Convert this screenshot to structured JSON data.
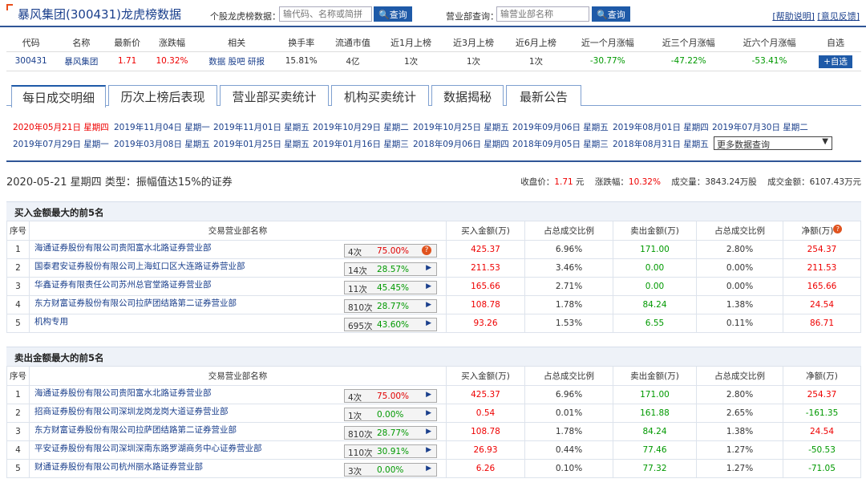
{
  "header": {
    "title": "暴风集团(300431)龙虎榜数据",
    "stock_label": "个股龙虎榜数据：",
    "stock_placeholder": "输代码、名称或简拼",
    "dept_label": "营业部查询：",
    "dept_placeholder": "输营业部名称",
    "search_btn": "查询",
    "help_link": "[帮助说明]",
    "feedback_link": "[意见反馈]"
  },
  "summary": {
    "headers": [
      "代码",
      "名称",
      "最新价",
      "涨跌幅",
      "相关",
      "换手率",
      "流通市值",
      "近1月上榜",
      "近3月上榜",
      "近6月上榜",
      "近一个月涨幅",
      "近三个月涨幅",
      "近六个月涨幅",
      "自选"
    ],
    "code": "300431",
    "name": "暴风集团",
    "price": "1.71",
    "change": "10.32%",
    "rel1": "数据",
    "rel2": "股吧",
    "rel3": "研报",
    "turnover": "15.81%",
    "mktcap": "4亿",
    "m1": "1次",
    "m3": "1次",
    "m6": "1次",
    "r1": "-30.77%",
    "r3": "-47.22%",
    "r6": "-53.41%",
    "add": "+自选"
  },
  "tabs": [
    "每日成交明细",
    "历次上榜后表现",
    "营业部买卖统计",
    "机构买卖统计",
    "数据揭秘",
    "最新公告"
  ],
  "dates": {
    "row1": [
      "2020年05月21日 星期四",
      "2019年11月04日 星期一",
      "2019年11月01日 星期五",
      "2019年10月29日 星期二",
      "2019年10月25日 星期五",
      "2019年09月06日 星期五",
      "2019年08月01日 星期四",
      "2019年07月30日 星期二"
    ],
    "row2": [
      "2019年07月29日 星期一",
      "2019年03月08日 星期五",
      "2019年01月25日 星期五",
      "2019年01月16日 星期三",
      "2018年09月06日 星期四",
      "2018年09月05日 星期三",
      "2018年08月31日 星期五"
    ],
    "more": "更多数据查询"
  },
  "info": {
    "line": "2020-05-21 星期四  类型：振幅值达15%的证券",
    "close_label": "收盘价：",
    "close": "1.71",
    "close_unit": "元",
    "chg_label": "涨跌幅：",
    "chg": "10.32%",
    "vol_label": "成交量：",
    "vol": "3843.24万股",
    "amt_label": "成交金额：",
    "amt": "6107.43万元"
  },
  "buy_title": "买入金额最大的前5名",
  "sell_title": "卖出金额最大的前5名",
  "table_headers": [
    "序号",
    "交易营业部名称",
    "买入金额(万)",
    "占总成交比例",
    "卖出金额(万)",
    "占总成交比例",
    "净额(万)"
  ],
  "buy_rows": [
    {
      "idx": "1",
      "name": "海通证券股份有限公司贵阳富水北路证券营业部",
      "n": "4次",
      "p": "75.00%",
      "buy": "425.37",
      "bp": "6.96%",
      "sell": "171.00",
      "sp": "2.80%",
      "net": "254.37"
    },
    {
      "idx": "2",
      "name": "国泰君安证券股份有限公司上海虹口区大连路证券营业部",
      "n": "14次",
      "p": "28.57%",
      "buy": "211.53",
      "bp": "3.46%",
      "sell": "0.00",
      "sp": "0.00%",
      "net": "211.53"
    },
    {
      "idx": "3",
      "name": "华鑫证券有限责任公司苏州总官堂路证券营业部",
      "n": "11次",
      "p": "45.45%",
      "buy": "165.66",
      "bp": "2.71%",
      "sell": "0.00",
      "sp": "0.00%",
      "net": "165.66"
    },
    {
      "idx": "4",
      "name": "东方财富证券股份有限公司拉萨团结路第二证券营业部",
      "n": "810次",
      "p": "28.77%",
      "buy": "108.78",
      "bp": "1.78%",
      "sell": "84.24",
      "sp": "1.38%",
      "net": "24.54"
    },
    {
      "idx": "5",
      "name": "机构专用",
      "n": "695次",
      "p": "43.60%",
      "buy": "93.26",
      "bp": "1.53%",
      "sell": "6.55",
      "sp": "0.11%",
      "net": "86.71"
    }
  ],
  "sell_rows": [
    {
      "idx": "1",
      "name": "海通证券股份有限公司贵阳富水北路证券营业部",
      "n": "4次",
      "p": "75.00%",
      "buy": "425.37",
      "bp": "6.96%",
      "sell": "171.00",
      "sp": "2.80%",
      "net": "254.37"
    },
    {
      "idx": "2",
      "name": "招商证券股份有限公司深圳龙岗龙岗大道证券营业部",
      "n": "1次",
      "p": "0.00%",
      "buy": "0.54",
      "bp": "0.01%",
      "sell": "161.88",
      "sp": "2.65%",
      "net": "-161.35"
    },
    {
      "idx": "3",
      "name": "东方财富证券股份有限公司拉萨团结路第二证券营业部",
      "n": "810次",
      "p": "28.77%",
      "buy": "108.78",
      "bp": "1.78%",
      "sell": "84.24",
      "sp": "1.38%",
      "net": "24.54"
    },
    {
      "idx": "4",
      "name": "平安证券股份有限公司深圳深南东路罗湖商务中心证券营业部",
      "n": "110次",
      "p": "30.91%",
      "buy": "26.93",
      "bp": "0.44%",
      "sell": "77.46",
      "sp": "1.27%",
      "net": "-50.53"
    },
    {
      "idx": "5",
      "name": "财通证券股份有限公司杭州丽水路证券营业部",
      "n": "3次",
      "p": "0.00%",
      "buy": "6.26",
      "bp": "0.10%",
      "sell": "77.32",
      "sp": "1.27%",
      "net": "-71.05"
    }
  ],
  "colors": {
    "up": "#e00000",
    "down": "#009900",
    "link": "#1a3f8c",
    "accent": "#1e5aa8"
  }
}
